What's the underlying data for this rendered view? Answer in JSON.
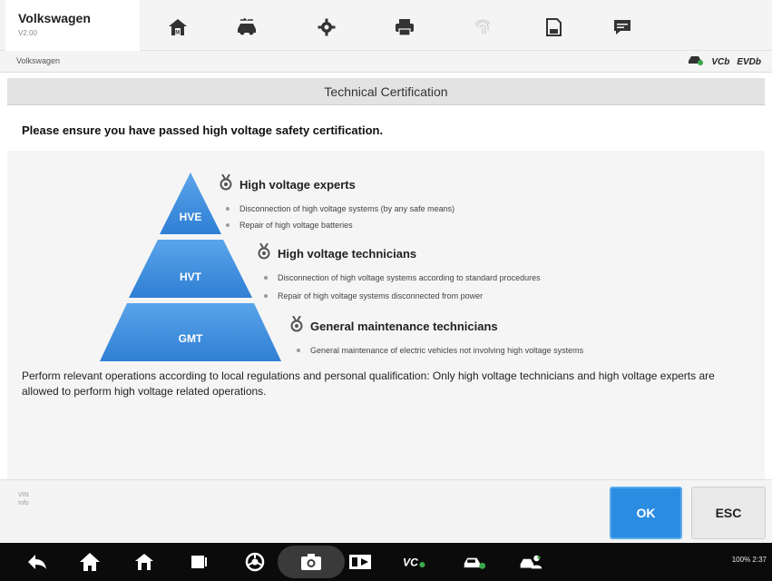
{
  "app": {
    "title": "Volkswagen",
    "version": "V2.00"
  },
  "toolbar": {
    "icons": [
      "home-icon",
      "vehicle-swap-icon",
      "settings-icon",
      "print-icon",
      "fingerprint-icon",
      "save-icon",
      "message-icon"
    ]
  },
  "breadcrumb": "Volkswagen",
  "status": {
    "vci": "VCb",
    "evdiag": "EVDb"
  },
  "page_title": "Technical Certification",
  "warning": "Please ensure you have passed high voltage safety certification.",
  "pyramid": {
    "top": "HVE",
    "middle": "HVT",
    "bottom": "GMT"
  },
  "levels": [
    {
      "title": "High voltage experts",
      "items": [
        "Disconnection of high voltage systems (by any safe means)",
        "Repair of high voltage batteries"
      ]
    },
    {
      "title": "High voltage technicians",
      "items": [
        "Disconnection of high voltage systems according to standard procedures",
        "Repair of high voltage systems disconnected from power"
      ]
    },
    {
      "title": "General maintenance technicians",
      "items": [
        "General maintenance of electric vehicles not involving high voltage systems"
      ]
    }
  ],
  "note": "Perform relevant operations according to local regulations and personal qualification: Only high voltage technicians and high voltage experts are allowed to perform high voltage related operations.",
  "vin": {
    "line1": "VIN",
    "line2": "Info"
  },
  "buttons": {
    "ok": "OK",
    "esc": "ESC"
  },
  "system_status": "100% 2:37",
  "colors": {
    "accent": "#2a8de2",
    "pyramid": "#3d8fe0",
    "navbar": "#0b0b0b"
  }
}
